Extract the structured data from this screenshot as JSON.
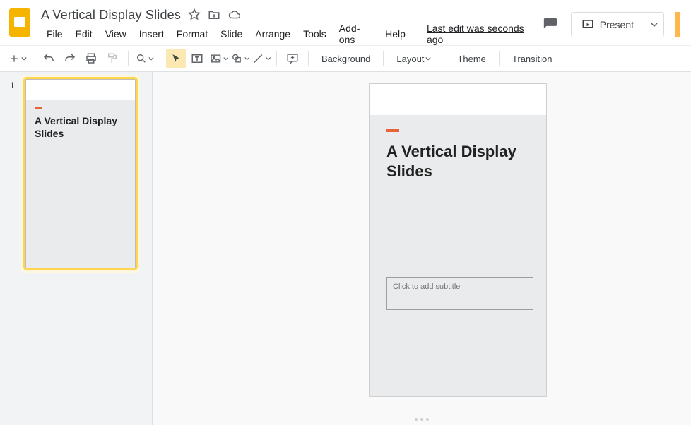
{
  "header": {
    "title": "A Vertical Display Slides",
    "last_edit": "Last edit was seconds ago"
  },
  "menus": [
    "File",
    "Edit",
    "View",
    "Insert",
    "Format",
    "Slide",
    "Arrange",
    "Tools",
    "Add-ons",
    "Help"
  ],
  "actions": {
    "present": "Present"
  },
  "toolbar": {
    "background": "Background",
    "layout": "Layout",
    "theme": "Theme",
    "transition": "Transition"
  },
  "filmstrip": {
    "items": [
      {
        "number": "1",
        "title": "A Vertical Display Slides"
      }
    ]
  },
  "slide": {
    "title": "A Vertical Display Slides",
    "subtitle_placeholder": "Click to add subtitle"
  }
}
